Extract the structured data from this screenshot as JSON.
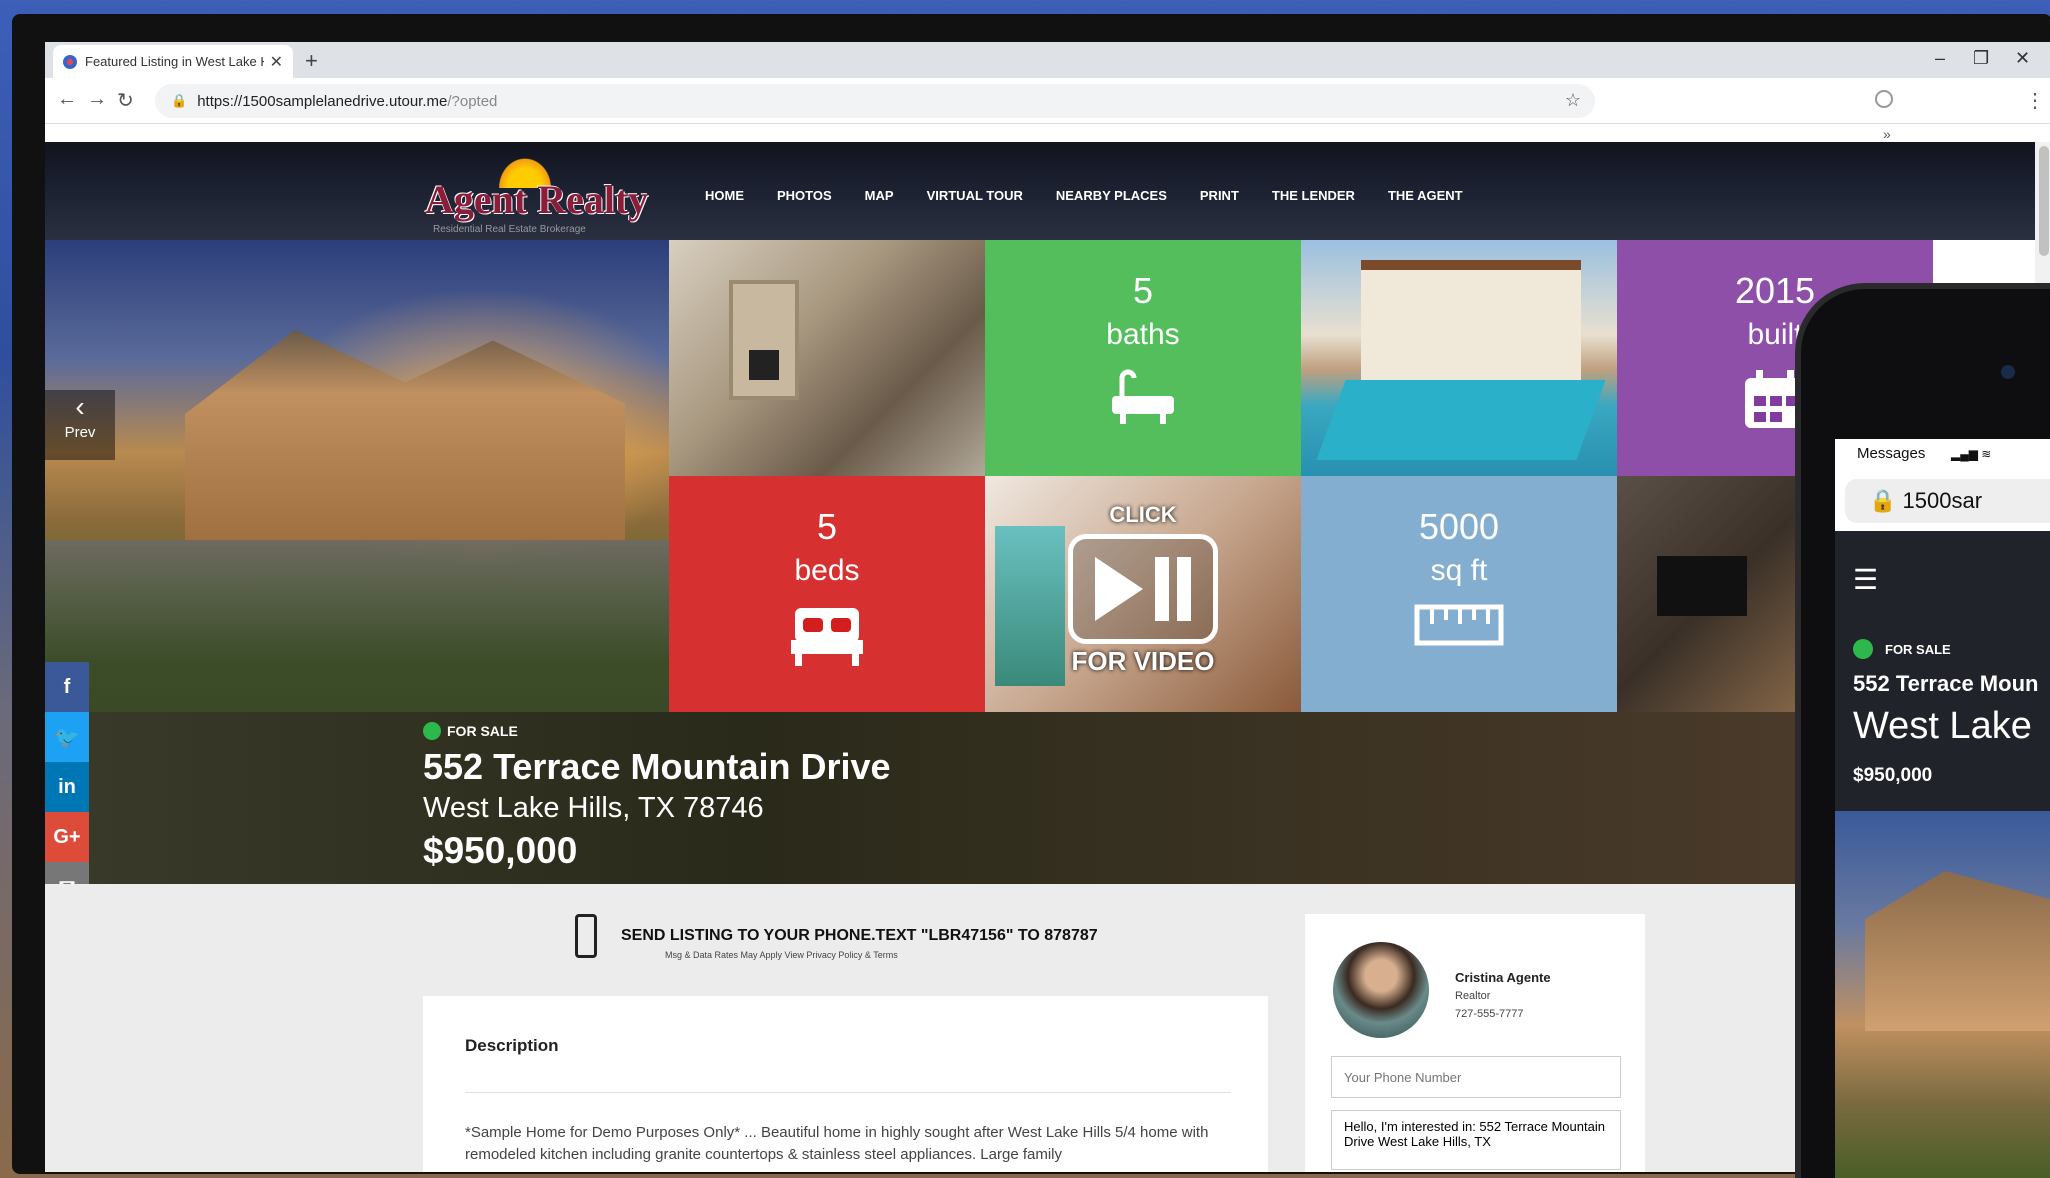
{
  "browser": {
    "tab_title": "Featured Listing in West Lake Hi",
    "new_tab": "+",
    "url_host": "https://1500samplelanedrive.utour.me",
    "url_path": "/?opted",
    "minimize": "–",
    "restore": "❐",
    "close": "✕"
  },
  "site": {
    "logo_text": "Agent Realty",
    "logo_subtitle": "Residential Real Estate Brokerage",
    "nav": [
      "HOME",
      "PHOTOS",
      "MAP",
      "VIRTUAL TOUR",
      "NEARBY PLACES",
      "PRINT",
      "THE LENDER",
      "THE AGENT"
    ]
  },
  "hero": {
    "prev_label": "Prev",
    "baths": {
      "num": "5",
      "unit": "baths",
      "icon": "bathtub-icon"
    },
    "built": {
      "num": "2015",
      "unit": "built",
      "icon": "calendar-icon"
    },
    "beds": {
      "num": "5",
      "unit": "beds",
      "icon": "bed-icon"
    },
    "sqft": {
      "num": "5000",
      "unit": "sq ft",
      "icon": "ruler-icon"
    },
    "video": {
      "top": "CLICK",
      "bottom": "FOR VIDEO"
    },
    "colors": {
      "baths": "#3cb446",
      "built": "#823ca0",
      "beds": "#d21e1e",
      "sqft": "#6ea0c8"
    }
  },
  "listing": {
    "status": "FOR SALE",
    "address": "552 Terrace Mountain Drive",
    "city": "West Lake Hills, TX 78746",
    "price": "$950,000"
  },
  "social": [
    {
      "icon": "facebook-icon",
      "glyph": "f",
      "color": "#3b5998"
    },
    {
      "icon": "twitter-icon",
      "glyph": "🐦",
      "color": "#1da1f2"
    },
    {
      "icon": "linkedin-icon",
      "glyph": "in",
      "color": "#0077b5"
    },
    {
      "icon": "google-plus-icon",
      "glyph": "G+",
      "color": "#dd4b39"
    },
    {
      "icon": "email-icon",
      "glyph": "✉",
      "color": "#777777"
    }
  ],
  "sms": {
    "main": "SEND LISTING TO YOUR PHONE.TEXT \"LBR47156\" TO 878787",
    "fine": "Msg & Data Rates May Apply View Privacy Policy & Terms"
  },
  "description": {
    "title": "Description",
    "text": "*Sample Home for Demo Purposes Only* ... Beautiful home in highly sought after West Lake Hills 5/4 home with remodeled kitchen including granite countertops & stainless steel appliances. Large family"
  },
  "agent": {
    "name": "Cristina Agente",
    "role": "Realtor",
    "phone": "727-555-7777",
    "phone_placeholder": "Your Phone Number",
    "message": "Hello, I'm interested in: 552 Terrace Mountain Drive West Lake Hills, TX"
  },
  "phone": {
    "status_app": "Messages",
    "url": "1500sar",
    "menu": "☰",
    "status": "FOR SALE",
    "address": "552 Terrace Moun",
    "city": "West Lake",
    "price": "$950,000"
  }
}
